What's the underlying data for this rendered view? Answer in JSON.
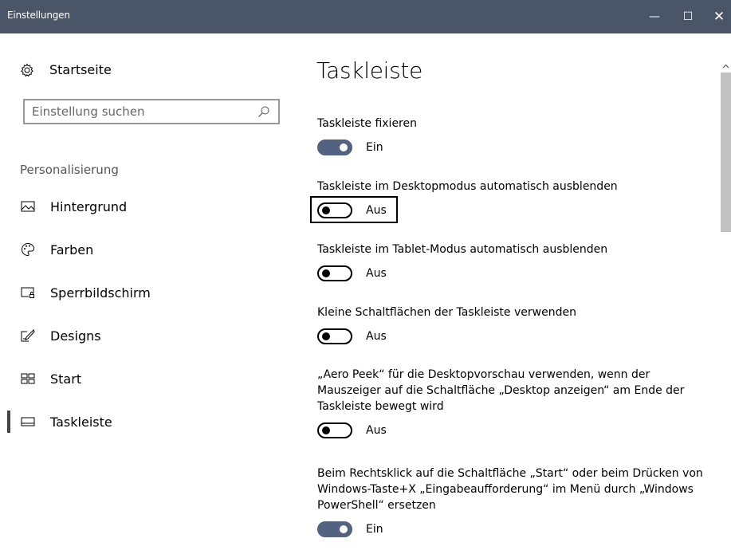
{
  "window": {
    "title": "Einstellungen",
    "controls": {
      "minimize": "—",
      "maximize": "☐",
      "close": "✕"
    }
  },
  "sidebar": {
    "home_label": "Startseite",
    "search_placeholder": "Einstellung suchen",
    "section_title": "Personalisierung",
    "items": [
      {
        "label": "Hintergrund",
        "icon": "picture-icon",
        "active": false
      },
      {
        "label": "Farben",
        "icon": "palette-icon",
        "active": false
      },
      {
        "label": "Sperrbildschirm",
        "icon": "lockscreen-icon",
        "active": false
      },
      {
        "label": "Designs",
        "icon": "brush-icon",
        "active": false
      },
      {
        "label": "Start",
        "icon": "start-tiles-icon",
        "active": false
      },
      {
        "label": "Taskleiste",
        "icon": "taskbar-icon",
        "active": true
      }
    ]
  },
  "content": {
    "title": "Taskleiste",
    "settings": [
      {
        "label": "Taskleiste fixieren",
        "state": "Ein",
        "on": true
      },
      {
        "label": "Taskleiste im Desktopmodus automatisch ausblenden",
        "state": "Aus",
        "on": false,
        "focused": true
      },
      {
        "label": "Taskleiste im Tablet-Modus automatisch ausblenden",
        "state": "Aus",
        "on": false
      },
      {
        "label": "Kleine Schaltflächen der Taskleiste verwenden",
        "state": "Aus",
        "on": false
      },
      {
        "label": "„Aero Peek“ für die Desktopvorschau verwenden, wenn der Mauszeiger auf die Schaltfläche „Desktop anzeigen“ am Ende der Taskleiste bewegt wird",
        "state": "Aus",
        "on": false
      },
      {
        "label": "Beim Rechtsklick auf die Schaltfläche „Start“ oder beim Drücken von Windows-Taste+X „Eingabeaufforderung“ im Menü durch „Windows PowerShell“ ersetzen",
        "state": "Ein",
        "on": true
      }
    ]
  },
  "colors": {
    "titlebar": "#4b5568",
    "toggle_on": "#536280",
    "active_indicator": "#444444"
  }
}
